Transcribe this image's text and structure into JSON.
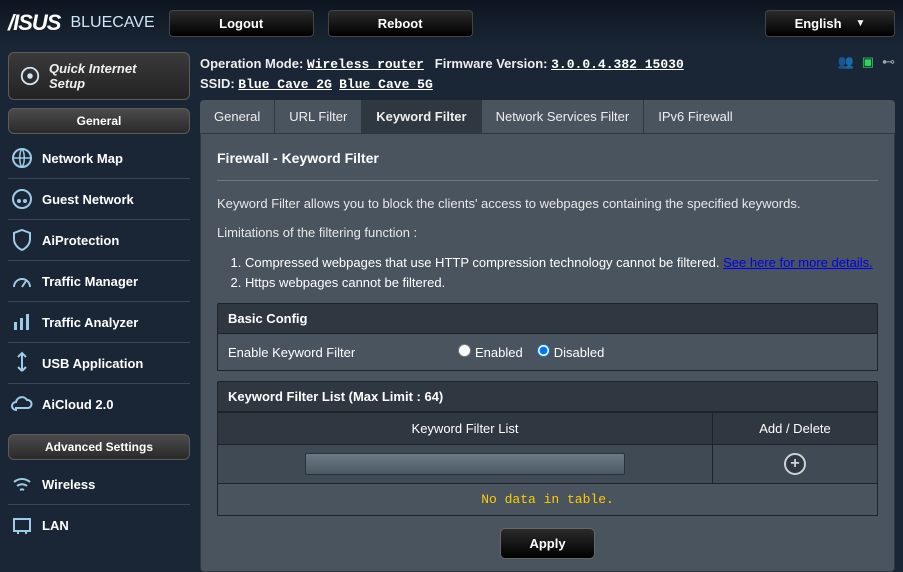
{
  "model": "BLUECAVE",
  "top": {
    "logout": "Logout",
    "reboot": "Reboot",
    "lang": "English"
  },
  "info": {
    "opmode_label": "Operation Mode:",
    "opmode": "Wireless router",
    "fw_label": "Firmware Version:",
    "fw": "3.0.0.4.382_15030",
    "ssid_label": "SSID:",
    "ssid1": "Blue Cave_2G",
    "ssid2": "Blue Cave_5G"
  },
  "quick": {
    "line1": "Quick Internet",
    "line2": "Setup"
  },
  "side": {
    "hdr1": "General",
    "hdr2": "Advanced Settings",
    "items1": [
      "Network Map",
      "Guest Network",
      "AiProtection",
      "Traffic Manager",
      "Traffic Analyzer",
      "USB Application",
      "AiCloud 2.0"
    ],
    "items2": [
      "Wireless",
      "LAN"
    ]
  },
  "tabs": [
    "General",
    "URL Filter",
    "Keyword Filter",
    "Network Services Filter",
    "IPv6 Firewall"
  ],
  "active_tab": 2,
  "page": {
    "title": "Firewall - Keyword Filter",
    "desc": "Keyword Filter allows you to block the clients' access to webpages containing the specified keywords.",
    "lim_label": "Limitations of the filtering function :",
    "lim1a": "Compressed webpages that use HTTP compression technology cannot be filtered. ",
    "lim1b": "See here for more details.",
    "lim2": "Https webpages cannot be filtered.",
    "basic_hdr": "Basic Config",
    "enable_label": "Enable Keyword Filter",
    "enabled": "Enabled",
    "disabled": "Disabled",
    "list_hdr": "Keyword Filter List (Max Limit : 64)",
    "col1": "Keyword Filter List",
    "col2": "Add / Delete",
    "nodata": "No data in table.",
    "apply": "Apply"
  }
}
